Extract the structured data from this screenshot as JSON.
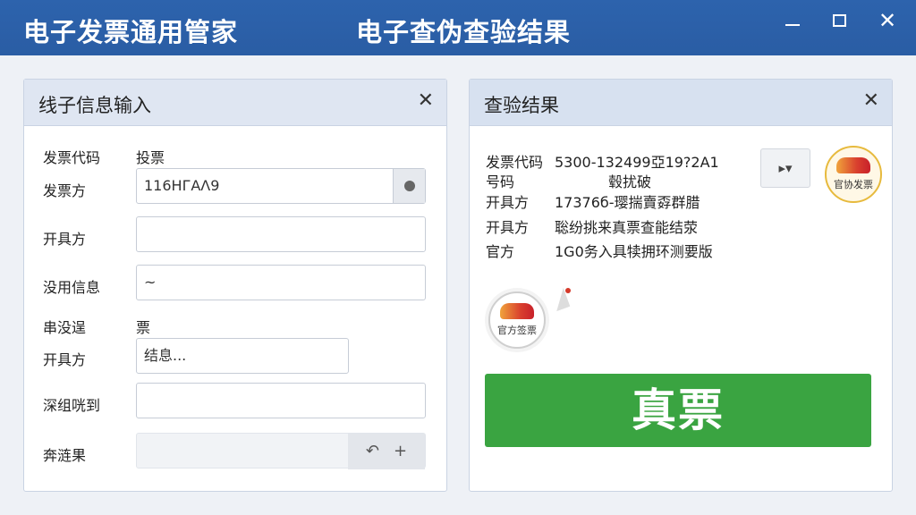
{
  "titlebar": {
    "app_title": "电子发票通用管家",
    "window_title": "电子查伪查验结果",
    "controls": {
      "minimize": "minimize-icon",
      "maximize": "maximize-icon",
      "close": "✕"
    }
  },
  "left_panel": {
    "title": "线子信息输入",
    "close": "✕",
    "rows": [
      {
        "label": "发票代码",
        "value": "投票"
      },
      {
        "label": "发票方",
        "value": "116HГAΛ9",
        "button_icon": "circle-icon"
      },
      {
        "label": "开具方",
        "value": ""
      },
      {
        "label": "没用信息",
        "value": "~"
      },
      {
        "label": "串没逞",
        "value": "票"
      },
      {
        "label": "开具方",
        "value": "结息..."
      },
      {
        "label": "深组咣到",
        "value": ""
      },
      {
        "label": "奔涟果",
        "tools": [
          "↶",
          "+"
        ]
      }
    ]
  },
  "right_panel": {
    "title": "查验结果",
    "close": "✕",
    "info": [
      {
        "label": "发票代码",
        "value": "5300-132499亞19?2A1"
      },
      {
        "label": "号码",
        "value": "毂扰破"
      },
      {
        "label": "开具方",
        "value": "17376б-璎揣賣孬群腊"
      },
      {
        "label": "开具方",
        "value": "聡纷挑来真票查能结荥"
      },
      {
        "label": "官方",
        "value": "1G0务入具犊拥环测要版"
      }
    ],
    "play_button": "▸▾",
    "seal_top": "官协发票",
    "seal_bottom": "官方签票",
    "result": "真票"
  },
  "colors": {
    "titlebar": "#2d63ad",
    "result_green": "#3aa441",
    "panel_head": "#dfe6f2"
  }
}
